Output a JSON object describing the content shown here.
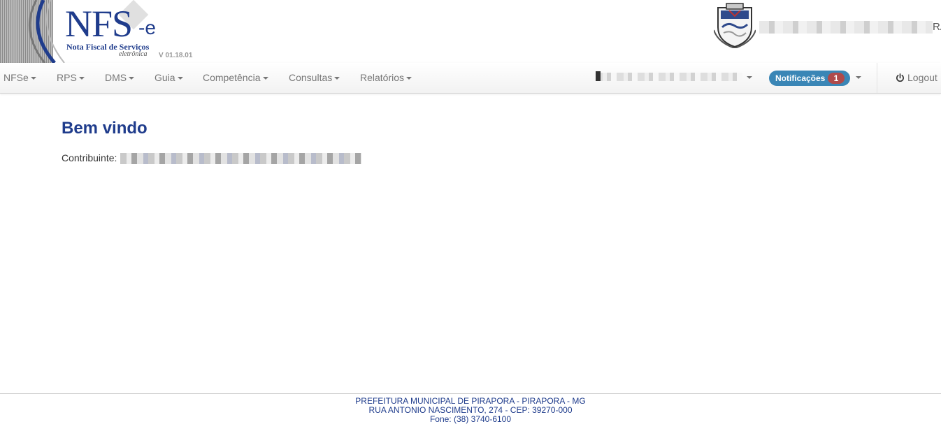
{
  "app": {
    "logo_title": "NFS",
    "logo_suffix": "-e",
    "logo_subtitle": "Nota Fiscal de Serviços",
    "logo_tagline": "eletrônica",
    "version": "V 01.18.01",
    "header_right_text": "RA"
  },
  "nav": {
    "items": [
      {
        "label": "NFSe"
      },
      {
        "label": "RPS"
      },
      {
        "label": "DMS"
      },
      {
        "label": "Guia"
      },
      {
        "label": "Competência"
      },
      {
        "label": "Consultas"
      },
      {
        "label": "Relatórios"
      }
    ],
    "notifications_label": "Notificações",
    "notifications_count": "1",
    "logout_label": "Logout"
  },
  "main": {
    "title": "Bem vindo",
    "contribuinte_label": "Contribuinte:"
  },
  "footer": {
    "line1": "PREFEITURA MUNICIPAL DE PIRAPORA - PIRAPORA - MG",
    "line2": "RUA ANTONIO NASCIMENTO, 274 - CEP: 39270-000",
    "line3": "Fone: (38) 3740-6100"
  },
  "colors": {
    "brand_blue": "#1f3c8c",
    "notification_blue": "#3a86b6",
    "badge_red": "#b04a4a"
  },
  "icons": {
    "logout": "power-icon",
    "dropdown": "caret-down-icon"
  }
}
